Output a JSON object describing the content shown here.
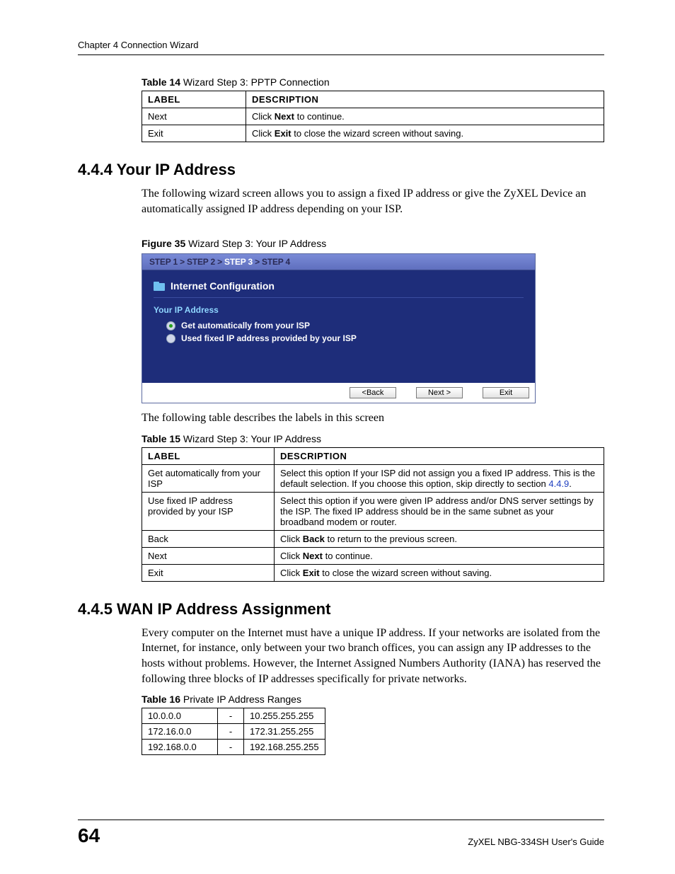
{
  "runningHead": "Chapter 4 Connection Wizard",
  "t14": {
    "caption_bold": "Table 14",
    "caption_rest": "   Wizard Step 3: PPTP Connection",
    "head": {
      "c1": "LABEL",
      "c2": "DESCRIPTION"
    },
    "rows": [
      {
        "label": "Next",
        "pre": "Click ",
        "bold": "Next",
        "post": " to continue."
      },
      {
        "label": "Exit",
        "pre": "Click ",
        "bold": "Exit",
        "post": " to close the wizard screen without saving."
      }
    ]
  },
  "s444": {
    "heading": "4.4.4  Your IP Address",
    "para": "The following wizard screen allows you to assign a fixed IP address or give the ZyXEL Device an automatically assigned IP address depending on your ISP."
  },
  "fig35": {
    "caption_bold": "Figure 35",
    "caption_rest": "   Wizard Step 3: Your IP Address"
  },
  "wizard": {
    "steps": {
      "s1": "STEP 1",
      "s2": "STEP 2",
      "s3": "STEP 3",
      "s4": "STEP 4",
      "sep": " > "
    },
    "title": "Internet Configuration",
    "subtitle": "Your IP Address",
    "opt1": "Get automatically from your ISP",
    "opt2": "Used fixed IP address provided by your ISP",
    "btn_back": "<Back",
    "btn_next": "Next >",
    "btn_exit": "Exit"
  },
  "afterFig": "The following table describes the labels in this screen",
  "t15": {
    "caption_bold": "Table 15",
    "caption_rest": "   Wizard Step 3: Your IP Address",
    "head": {
      "c1": "LABEL",
      "c2": "DESCRIPTION"
    },
    "rows": [
      {
        "label": "Get automatically from your ISP",
        "desc_pre": "Select this option If your ISP did not assign you a fixed IP address. This is the default selection. If you choose this option, skip directly to section ",
        "link": "4.4.9",
        "desc_post": "."
      },
      {
        "label": "Use fixed IP address provided by your ISP",
        "desc": "Select this option if you were given IP address and/or DNS server settings by the ISP. The fixed IP address should be in the same subnet as your broadband modem or router."
      },
      {
        "label": "Back",
        "pre": "Click ",
        "bold": "Back",
        "post": " to return to the previous screen."
      },
      {
        "label": "Next",
        "pre": "Click ",
        "bold": "Next",
        "post": " to continue."
      },
      {
        "label": "Exit",
        "pre": "Click ",
        "bold": "Exit",
        "post": " to close the wizard screen without saving."
      }
    ]
  },
  "s445": {
    "heading": "4.4.5  WAN IP Address Assignment",
    "para": "Every computer on the Internet must have a unique IP address. If your networks are isolated from the Internet, for instance, only between your two branch offices, you can assign any IP addresses to the hosts without problems. However, the Internet Assigned Numbers Authority (IANA) has reserved the following three blocks of IP addresses specifically for private networks."
  },
  "t16": {
    "caption_bold": "Table 16",
    "caption_rest": "   Private IP Address Ranges",
    "rows": [
      {
        "a": "10.0.0.0",
        "dash": "-",
        "b": "10.255.255.255"
      },
      {
        "a": "172.16.0.0",
        "dash": "-",
        "b": "172.31.255.255"
      },
      {
        "a": "192.168.0.0",
        "dash": "-",
        "b": "192.168.255.255"
      }
    ]
  },
  "footer": {
    "page": "64",
    "guide": "ZyXEL NBG-334SH User's Guide"
  }
}
